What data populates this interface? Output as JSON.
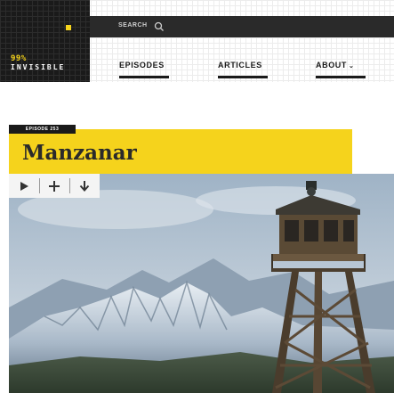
{
  "header": {
    "logo": {
      "percent": "99%",
      "word": "INVISIBLE",
      "accent": "#f5d31c"
    },
    "search": {
      "label": "SEARCH",
      "icon": "search-icon"
    },
    "nav": [
      {
        "label": "EPISODES"
      },
      {
        "label": "ARTICLES"
      },
      {
        "label": "ABOUT",
        "icon": "chevron-down-icon"
      }
    ]
  },
  "episode": {
    "badge": "EPISODE 253",
    "title": "Manzanar",
    "accent": "#f5d31c"
  },
  "player": {
    "controls": [
      {
        "icon": "play-icon"
      },
      {
        "icon": "plus-icon"
      },
      {
        "icon": "download-icon"
      }
    ]
  },
  "hero": {
    "subject": "guard tower in front of snow-capped mountains"
  }
}
